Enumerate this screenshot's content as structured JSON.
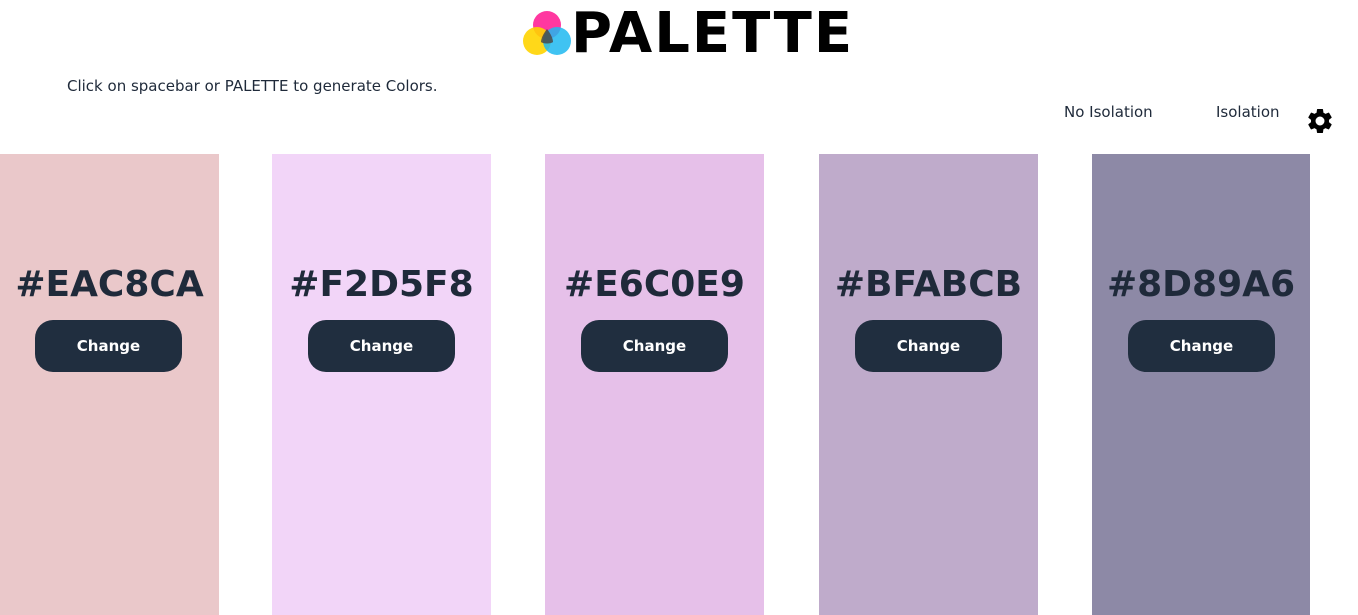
{
  "app": {
    "logo_text": "PALETTE",
    "hint": "Click on spacebar or PALETTE to generate Colors."
  },
  "isolation": {
    "no_isolation_label": "No Isolation",
    "isolation_label": "Isolation"
  },
  "swatches": [
    {
      "hex": "#EAC8CA",
      "button_label": "Change"
    },
    {
      "hex": "#F2D5F8",
      "button_label": "Change"
    },
    {
      "hex": "#E6C0E9",
      "button_label": "Change"
    },
    {
      "hex": "#BFABCB",
      "button_label": "Change"
    },
    {
      "hex": "#8D89A6",
      "button_label": "Change"
    }
  ],
  "colors": {
    "text": "#1f2a3a",
    "button_bg": "#202e3f",
    "logo_magenta": "#ff2d9b",
    "logo_yellow": "#ffd400",
    "logo_cyan": "#1fb8f0"
  }
}
